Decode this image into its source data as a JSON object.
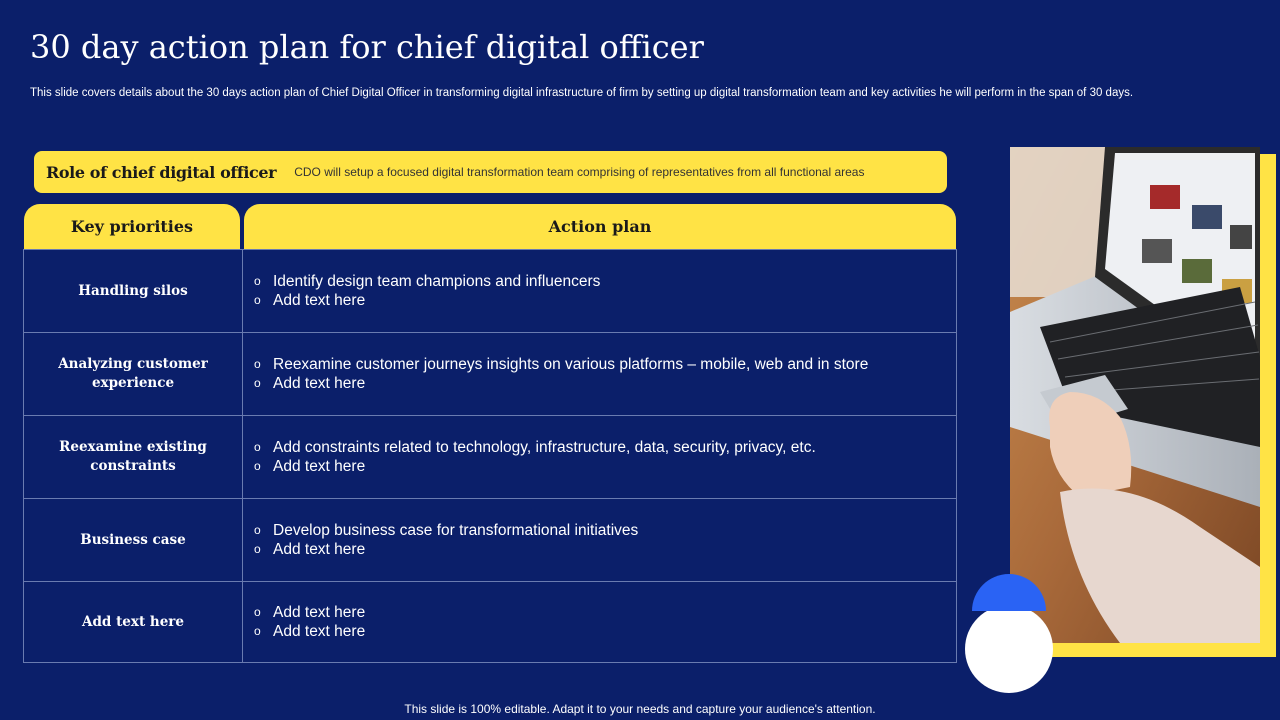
{
  "slide": {
    "title": "30 day action plan for chief digital officer",
    "subtitle": "This slide covers details about the 30 days action plan of Chief Digital Officer in transforming digital infrastructure of firm by setting up digital transformation team and key activities he will perform in the span of 30 days.",
    "footer": "This slide is 100% editable. Adapt it to your needs and capture your audience's attention."
  },
  "role": {
    "title": "Role of chief digital officer",
    "text": "CDO will setup a focused digital transformation team comprising of representatives  from all functional areas"
  },
  "table": {
    "headers": {
      "left": "Key priorities",
      "right": "Action plan"
    },
    "rows": [
      {
        "priority": "Handling silos",
        "bullets": [
          "Identify  design team champions and influencers",
          "Add text here"
        ]
      },
      {
        "priority": "Analyzing customer experience",
        "bullets": [
          "Reexamine customer journeys  insights on various platforms – mobile, web and in store",
          "Add text here"
        ]
      },
      {
        "priority": "Reexamine existing constraints",
        "bullets": [
          "Add constraints related to technology,  infrastructure,  data,  security,  privacy,  etc.",
          "Add text here"
        ]
      },
      {
        "priority": "Business case",
        "bullets": [
          "Develop business case for transformational  initiatives",
          "Add text here"
        ]
      },
      {
        "priority": "Add text here",
        "bullets": [
          "Add text here",
          "Add text here"
        ]
      }
    ]
  },
  "bullet_symbol": "o",
  "colors": {
    "background": "#0b1f6a",
    "accent": "#ffe345",
    "blue_accent": "#2a63f4"
  },
  "icons": {
    "bullet": "hollow-circle-bullet-icon"
  }
}
